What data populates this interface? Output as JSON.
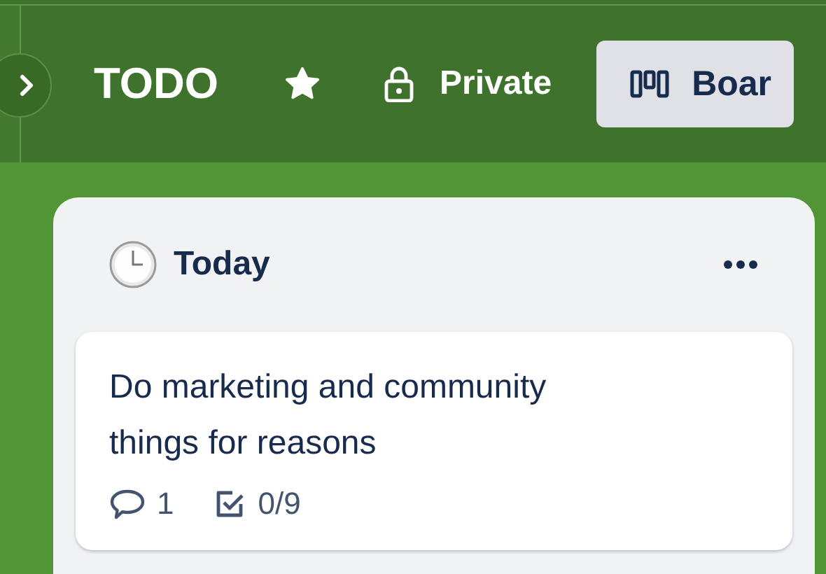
{
  "header": {
    "title": "TODO",
    "starred": true,
    "visibility": "Private",
    "view_button": "Boar"
  },
  "list": {
    "title": "Today",
    "cards": [
      {
        "title": "Do marketing and community things for reasons",
        "comments": "1",
        "checklist": "0/9"
      }
    ]
  }
}
